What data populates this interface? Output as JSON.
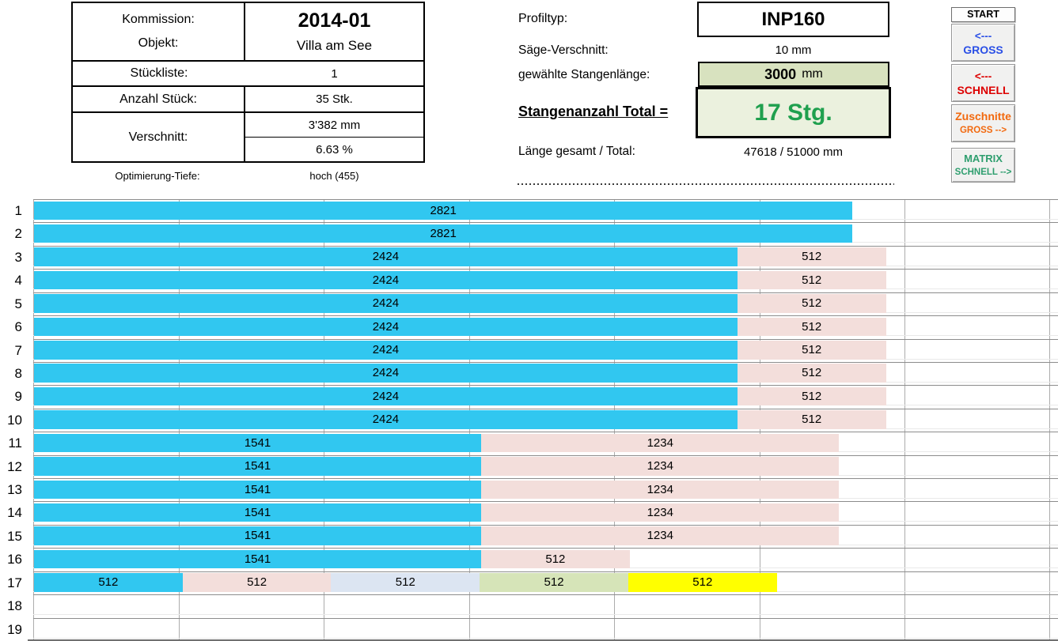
{
  "left_table": {
    "kommission_label": "Kommission:",
    "kommission_value": "2014-01",
    "objekt_label": "Objekt:",
    "objekt_value": "Villa am See",
    "stueckliste_label": "Stückliste:",
    "stueckliste_value": "1",
    "anzahl_label": "Anzahl Stück:",
    "anzahl_value": "35 Stk.",
    "verschnitt_label": "Verschnitt:",
    "verschnitt_mm": "3'382 mm",
    "verschnitt_pct": "6.63 %",
    "optimierung_label": "Optimierung-Tiefe:",
    "optimierung_value": "hoch (455)"
  },
  "profile": {
    "profiltyp_label": "Profiltyp:",
    "profiltyp_value": "INP160",
    "saege_label": "Säge-Verschnitt:",
    "saege_value": "10 mm",
    "stangenlaenge_label": "gewählte Stangenlänge:",
    "stangenlaenge_value": "3000",
    "stangenlaenge_unit": "mm",
    "stangenanzahl_label": "Stangenanzahl Total =",
    "stangenanzahl_value": "17 Stg.",
    "laenge_label": "Länge gesamt / Total:",
    "laenge_value": "47618 / 51000 mm"
  },
  "buttons": {
    "start": "START",
    "gross_arrow": "<---",
    "gross": "GROSS",
    "schnell_arrow": "<---",
    "schnell": "SCHNELL",
    "zuschnitte": "Zuschnitte",
    "zuschnitte_sub": "GROSS -->",
    "matrix": "MATRIX",
    "matrix_sub": "SCHNELL -->"
  },
  "colors": {
    "accent_green_text": "#1fa04e",
    "box_green_light": "#ebf1de",
    "box_green": "#d8e2bf",
    "btn_blue": "#2b50e6",
    "btn_red": "#dd0000",
    "btn_orange": "#f2690e",
    "btn_green": "#2e9e6e"
  },
  "chart_data": {
    "type": "bar",
    "orientation": "horizontal-stacked",
    "unit": "mm",
    "bar_scale_max_mm": 3000,
    "colors": {
      "cyan": "#31c7f0",
      "pink": "#f3dedb",
      "lightblue": "#dce5f2",
      "lightgreen": "#d6e4b8",
      "yellow": "#ffff00"
    },
    "rows": [
      {
        "num": "1",
        "segments": [
          {
            "value": 2821,
            "color": "cyan"
          }
        ]
      },
      {
        "num": "2",
        "segments": [
          {
            "value": 2821,
            "color": "cyan"
          }
        ]
      },
      {
        "num": "3",
        "segments": [
          {
            "value": 2424,
            "color": "cyan"
          },
          {
            "value": 512,
            "color": "pink"
          }
        ]
      },
      {
        "num": "4",
        "segments": [
          {
            "value": 2424,
            "color": "cyan"
          },
          {
            "value": 512,
            "color": "pink"
          }
        ]
      },
      {
        "num": "5",
        "segments": [
          {
            "value": 2424,
            "color": "cyan"
          },
          {
            "value": 512,
            "color": "pink"
          }
        ]
      },
      {
        "num": "6",
        "segments": [
          {
            "value": 2424,
            "color": "cyan"
          },
          {
            "value": 512,
            "color": "pink"
          }
        ]
      },
      {
        "num": "7",
        "segments": [
          {
            "value": 2424,
            "color": "cyan"
          },
          {
            "value": 512,
            "color": "pink"
          }
        ]
      },
      {
        "num": "8",
        "segments": [
          {
            "value": 2424,
            "color": "cyan"
          },
          {
            "value": 512,
            "color": "pink"
          }
        ]
      },
      {
        "num": "9",
        "segments": [
          {
            "value": 2424,
            "color": "cyan"
          },
          {
            "value": 512,
            "color": "pink"
          }
        ]
      },
      {
        "num": "10",
        "segments": [
          {
            "value": 2424,
            "color": "cyan"
          },
          {
            "value": 512,
            "color": "pink"
          }
        ]
      },
      {
        "num": "11",
        "segments": [
          {
            "value": 1541,
            "color": "cyan"
          },
          {
            "value": 1234,
            "color": "pink"
          }
        ]
      },
      {
        "num": "12",
        "segments": [
          {
            "value": 1541,
            "color": "cyan"
          },
          {
            "value": 1234,
            "color": "pink"
          }
        ]
      },
      {
        "num": "13",
        "segments": [
          {
            "value": 1541,
            "color": "cyan"
          },
          {
            "value": 1234,
            "color": "pink"
          }
        ]
      },
      {
        "num": "14",
        "segments": [
          {
            "value": 1541,
            "color": "cyan"
          },
          {
            "value": 1234,
            "color": "pink"
          }
        ]
      },
      {
        "num": "15",
        "segments": [
          {
            "value": 1541,
            "color": "cyan"
          },
          {
            "value": 1234,
            "color": "pink"
          }
        ]
      },
      {
        "num": "16",
        "segments": [
          {
            "value": 1541,
            "color": "cyan"
          },
          {
            "value": 512,
            "color": "pink"
          }
        ]
      },
      {
        "num": "17",
        "segments": [
          {
            "value": 512,
            "color": "cyan"
          },
          {
            "value": 512,
            "color": "pink"
          },
          {
            "value": 512,
            "color": "lightblue"
          },
          {
            "value": 512,
            "color": "lightgreen"
          },
          {
            "value": 512,
            "color": "yellow"
          }
        ]
      },
      {
        "num": "18",
        "segments": []
      },
      {
        "num": "19",
        "segments": []
      }
    ]
  }
}
